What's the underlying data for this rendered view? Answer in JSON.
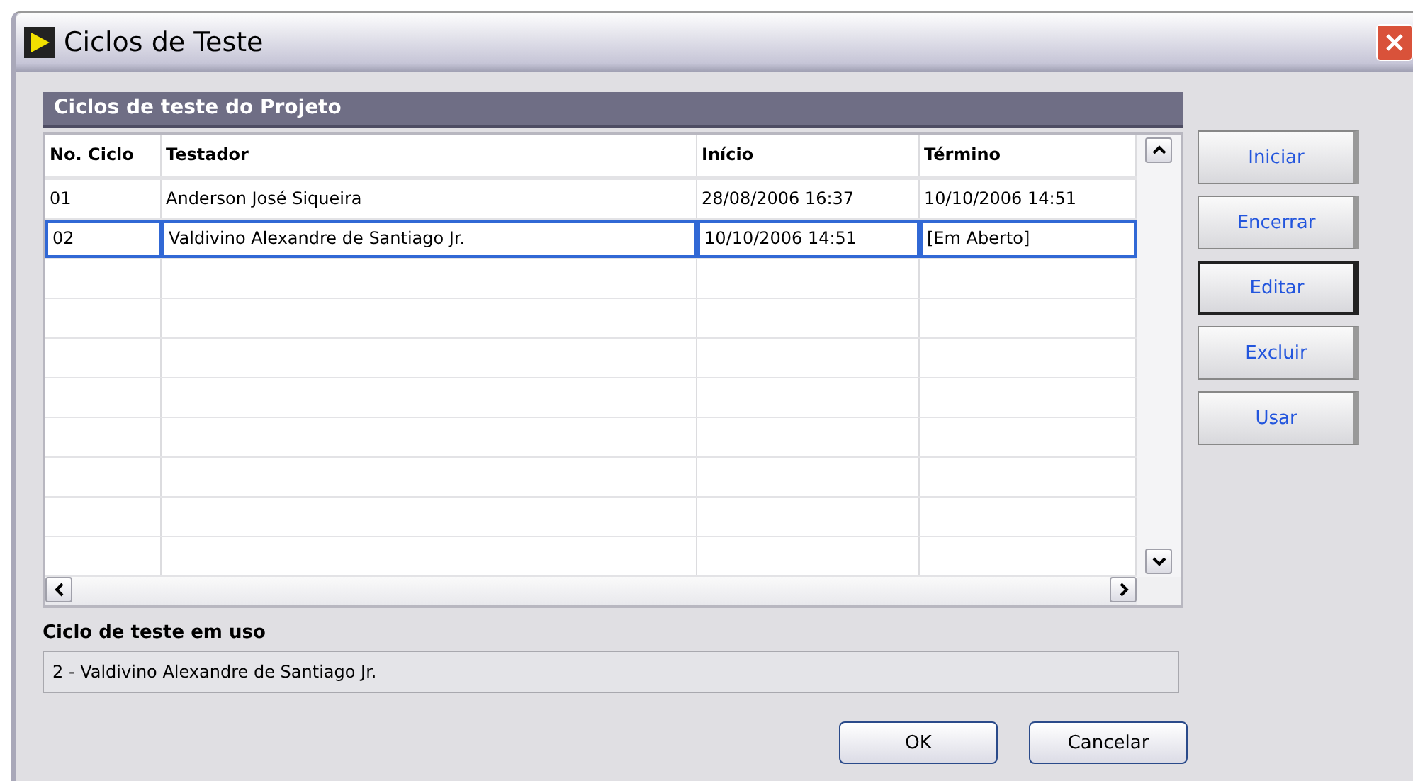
{
  "window": {
    "title": "Ciclos de Teste"
  },
  "panel": {
    "title": "Ciclos de teste do Projeto"
  },
  "table": {
    "columns": [
      "No. Ciclo",
      "Testador",
      "Início",
      "Término"
    ],
    "rows": [
      {
        "cells": [
          "01",
          "Anderson José Siqueira",
          "28/08/2006 16:37",
          "10/10/2006 14:51"
        ],
        "selected": false
      },
      {
        "cells": [
          "02",
          "Valdivino Alexandre de Santiago Jr.",
          "10/10/2006 14:51",
          "[Em Aberto]"
        ],
        "selected": true
      }
    ]
  },
  "side_buttons": [
    {
      "label": "Iniciar",
      "focused": false
    },
    {
      "label": "Encerrar",
      "focused": false
    },
    {
      "label": "Editar",
      "focused": true
    },
    {
      "label": "Excluir",
      "focused": false
    },
    {
      "label": "Usar",
      "focused": false
    }
  ],
  "in_use": {
    "label": "Ciclo de teste em uso",
    "value": "2 - Valdivino Alexandre de Santiago Jr."
  },
  "buttons": [
    "OK",
    "Cancelar"
  ]
}
